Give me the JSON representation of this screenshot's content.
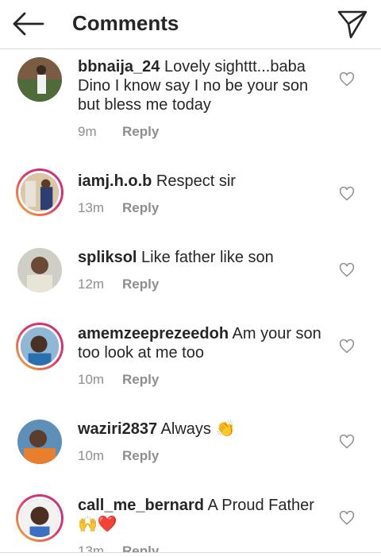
{
  "header": {
    "title": "Comments",
    "back_icon": "arrow-left-icon",
    "share_icon": "paper-plane-icon"
  },
  "comments": [
    {
      "username": "bbnaija_24",
      "text": "Lovely sighttt...baba Dino I know say I no be your son but bless me today",
      "time": "9m",
      "reply": "Reply",
      "emoji": "",
      "story_ring": false
    },
    {
      "username": "iamj.h.o.b",
      "text": "Respect sir",
      "time": "13m",
      "reply": "Reply",
      "emoji": "",
      "story_ring": true
    },
    {
      "username": "spliksol",
      "text": "Like father like son",
      "time": "12m",
      "reply": "Reply",
      "emoji": "",
      "story_ring": false
    },
    {
      "username": "amemzeeprezeedoh",
      "text": "Am your son too look at me too",
      "time": "10m",
      "reply": "Reply",
      "emoji": "",
      "story_ring": true
    },
    {
      "username": "waziri2837",
      "text": "Always",
      "time": "10m",
      "reply": "Reply",
      "emoji": "👏",
      "story_ring": false
    },
    {
      "username": "call_me_bernard",
      "text": "A Proud Father",
      "time": "13m",
      "reply": "Reply",
      "emoji": "🙌❤️",
      "story_ring": true
    }
  ],
  "colors": {
    "text": "#262626",
    "meta": "#8e8e8e",
    "ring_start": "#f9b233",
    "ring_end": "#c13584"
  }
}
